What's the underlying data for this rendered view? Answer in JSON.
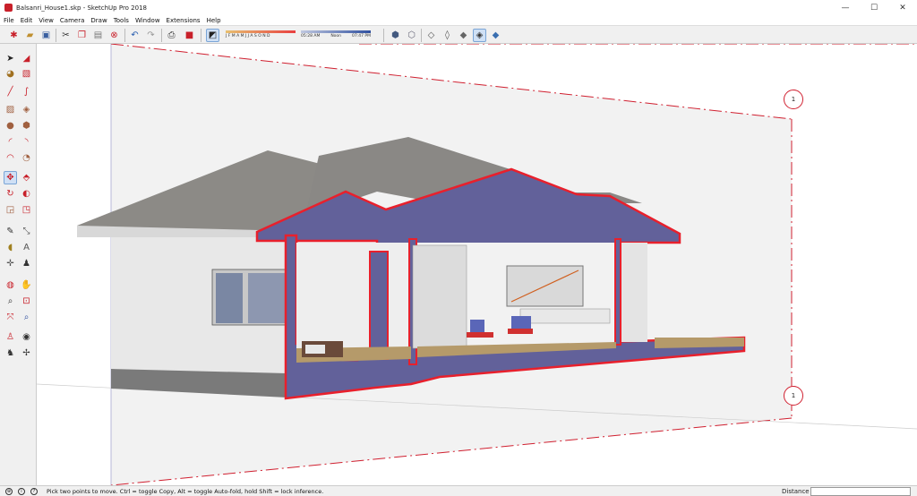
{
  "window": {
    "title": "Balsanri_House1.skp - SketchUp Pro 2018",
    "controls": {
      "minimize": "—",
      "maximize": "☐",
      "close": "✕"
    }
  },
  "menu": [
    "File",
    "Edit",
    "View",
    "Camera",
    "Draw",
    "Tools",
    "Window",
    "Extensions",
    "Help"
  ],
  "toolbar": {
    "shadow_months": "J F M A M J J A S O N D",
    "time_start": "05:28 AM",
    "time_noon": "Noon",
    "time_end": "07:47 PM"
  },
  "section_marks": {
    "top": "1",
    "bottom": "1"
  },
  "colors": {
    "section_fill": "#62619a",
    "section_outline": "#e8202c",
    "roof": "#8c8a86",
    "wall": "#e6e6e6"
  },
  "status": {
    "message": "Pick two points to move.  Ctrl = toggle Copy, Alt = toggle Auto-fold, hold Shift = lock inference.",
    "distance_label": "Distance",
    "distance_value": ""
  }
}
